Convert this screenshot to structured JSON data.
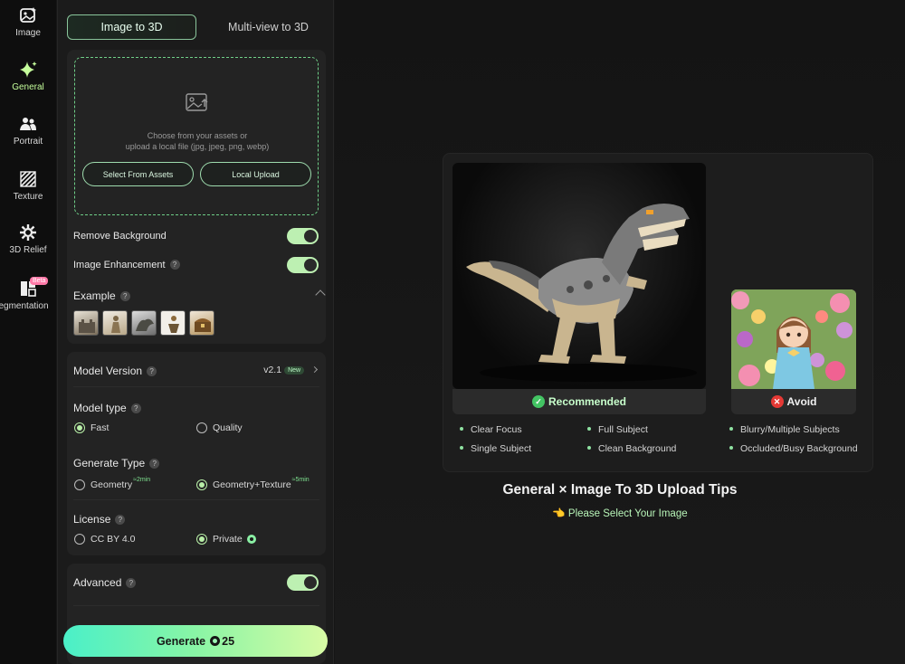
{
  "rail": {
    "items": [
      {
        "label": "Image",
        "icon": "image-sparkle-icon"
      },
      {
        "label": "General",
        "icon": "sparkle-icon",
        "active": true
      },
      {
        "label": "Portrait",
        "icon": "people-icon"
      },
      {
        "label": "Texture",
        "icon": "stripes-icon"
      },
      {
        "label": "3D Relief",
        "icon": "gear-icon"
      },
      {
        "label": "egmentation",
        "icon": "segments-icon",
        "badge": "Beta"
      }
    ]
  },
  "tabs": {
    "image_to_3d": "Image to 3D",
    "multiview_to_3d": "Multi-view to 3D"
  },
  "upload": {
    "line1": "Choose from your assets or",
    "line2": "upload a local file (jpg, jpeg, png, webp)",
    "select_assets": "Select From Assets",
    "local_upload": "Local Upload"
  },
  "options": {
    "remove_background": "Remove Background",
    "remove_background_on": true,
    "image_enhancement": "Image Enhancement",
    "image_enhancement_on": true,
    "example": "Example",
    "help": "?"
  },
  "model": {
    "version_label": "Model Version",
    "version_value": "v2.1",
    "version_badge": "New",
    "type_label": "Model type",
    "type_fast": "Fast",
    "type_quality": "Quality",
    "type_selected": "Fast",
    "generate_type_label": "Generate Type",
    "geometry": "Geometry",
    "geometry_time": "≈2min",
    "geometry_texture": "Geometry+Texture",
    "geometry_texture_time": "≈5min",
    "generate_type_selected": "Geometry+Texture",
    "license_label": "License",
    "license_cc": "CC BY 4.0",
    "license_private": "Private",
    "license_selected": "Private",
    "advanced_label": "Advanced",
    "advanced_on": true
  },
  "generate": {
    "label": "Generate",
    "cost": "25"
  },
  "tips": {
    "recommended": "Recommended",
    "avoid": "Avoid",
    "good": [
      "Clear Focus",
      "Full Subject",
      "Single Subject",
      "Clean Background"
    ],
    "bad": [
      "Blurry/Multiple Subjects",
      "Occluded/Busy Background"
    ],
    "title": "General × Image To 3D Upload Tips",
    "subtitle": "Please Select Your Image",
    "subtitle_emoji": "👈"
  },
  "colors": {
    "accent": "#8ef0a8",
    "toggle": "#bdf0b2",
    "avoid_red": "#e53935",
    "rec_green": "#43c463"
  }
}
